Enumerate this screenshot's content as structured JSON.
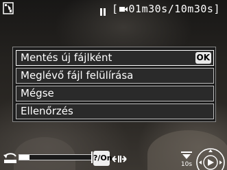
{
  "status": {
    "timer_elapsed": "01m30s",
    "timer_total": "10m30s",
    "timer_separator": "/"
  },
  "dialog": {
    "items": [
      {
        "label": "Mentés új fájlként",
        "badge": "OK"
      },
      {
        "label": "Meglévő fájl felülírása"
      },
      {
        "label": "Mégse"
      },
      {
        "label": "Ellenőrzés"
      }
    ]
  },
  "playback": {
    "progress_fraction": 0.14,
    "edit_button_label": "?/On",
    "skip_label": "10s"
  },
  "icons": {
    "mode": "movie-edit-icon",
    "pause": "pause-icon",
    "camera": "movie-camera-icon",
    "rewind": "rewind-icon",
    "trim": "trim-icon",
    "skip": "skip-10s-icon",
    "multi_selector": "multi-selector-icon"
  },
  "colors": {
    "menu_background": "#1c1c1c",
    "menu_border": "#bdbdbd",
    "text": "#ffffff"
  }
}
